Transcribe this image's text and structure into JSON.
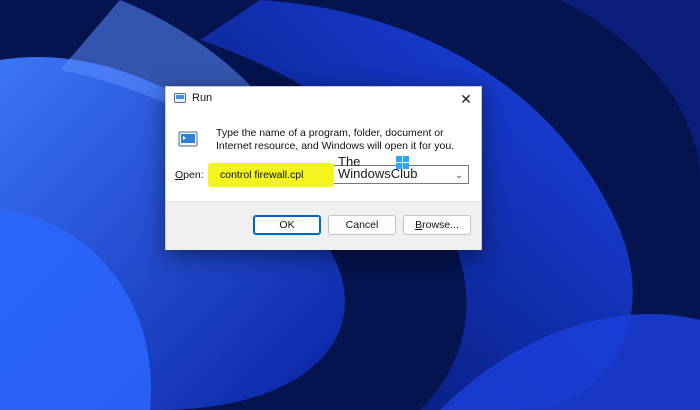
{
  "window": {
    "title": "Run",
    "close_glyph": "✕",
    "title_icon": "run-app-icon"
  },
  "dialog": {
    "description": "Type the name of a program, folder, document or Internet resource, and Windows will open it for you.",
    "open_label_prefix": "O",
    "open_label_rest": "pen:",
    "open_value": "control firewall.cpl",
    "dropdown_icon": "chevron-down-icon"
  },
  "watermark": {
    "line1": "The",
    "line2": "WindowsClub"
  },
  "buttons": {
    "ok": "OK",
    "cancel": "Cancel",
    "browse_prefix": "B",
    "browse_rest": "rowse..."
  },
  "colors": {
    "highlight": "#f4f41e",
    "accent": "#0067c0",
    "wallpaper_primary": "#0b2fd6"
  }
}
